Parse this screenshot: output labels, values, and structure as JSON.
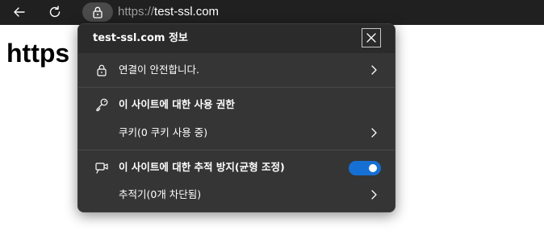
{
  "toolbar": {
    "back_icon": "arrow-left-icon",
    "refresh_icon": "refresh-icon",
    "site_info_icon": "lock-icon",
    "url_scheme": "https://",
    "url_host": "test-ssl.com"
  },
  "page": {
    "heading": "https"
  },
  "popup": {
    "title": "test-ssl.com 정보",
    "close_icon": "close-icon",
    "connection": {
      "icon": "lock-icon",
      "label": "연결이 안전합니다."
    },
    "permissions": {
      "icon": "key-icon",
      "label": "이 사이트에 대한 사용 권한"
    },
    "cookies": {
      "label": "쿠키(0 쿠키 사용 중)"
    },
    "tracking": {
      "icon": "tracking-camera-icon",
      "label": "이 사이트에 대한 추적 방지(균형 조정)",
      "toggle_on": true,
      "toggle_color": "#1670d4"
    },
    "trackers": {
      "label": "추적기(0개 차단됨)"
    }
  }
}
